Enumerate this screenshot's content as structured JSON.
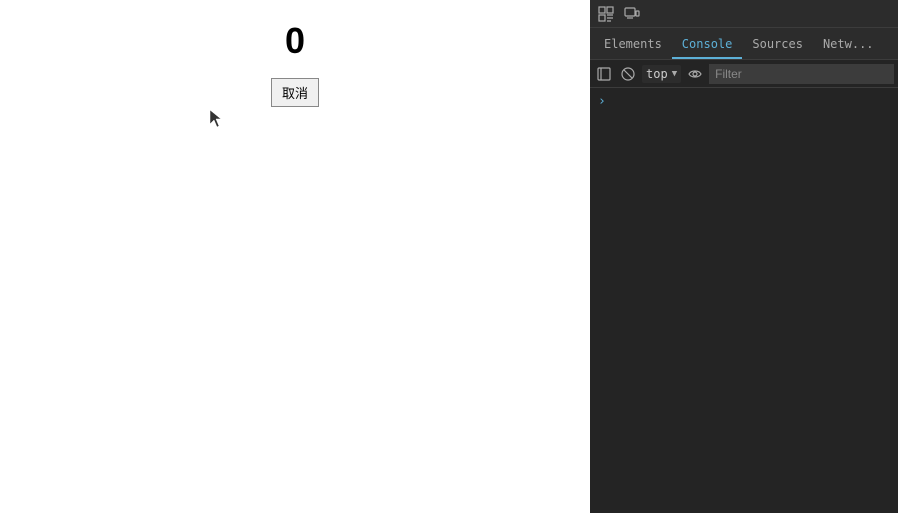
{
  "main": {
    "counter_value": "0",
    "cancel_button_label": "取消"
  },
  "devtools": {
    "tabs": [
      {
        "label": "Elements",
        "active": false
      },
      {
        "label": "Console",
        "active": true
      },
      {
        "label": "Sources",
        "active": false
      },
      {
        "label": "Netwo...",
        "active": false
      }
    ],
    "console_toolbar": {
      "context_label": "top",
      "filter_placeholder": "Filter"
    },
    "icons": {
      "inspect": "⬚",
      "device": "☐",
      "clear": "🚫",
      "eye": "👁",
      "chevron": "▼",
      "prompt": "›"
    }
  }
}
